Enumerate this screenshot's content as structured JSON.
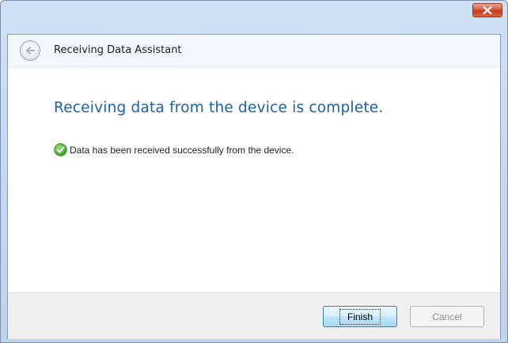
{
  "window": {
    "title": "Receiving Data Assistant"
  },
  "content": {
    "heading": "Receiving data from the device is complete.",
    "status_message": "Data has been received successfully from the device.",
    "status_icon": "success-check-icon"
  },
  "buttons": {
    "finish_label": "Finish",
    "cancel_label": "Cancel"
  },
  "colors": {
    "heading": "#1e5fa8",
    "success": "#3fae29",
    "close_button": "#c7391f"
  }
}
